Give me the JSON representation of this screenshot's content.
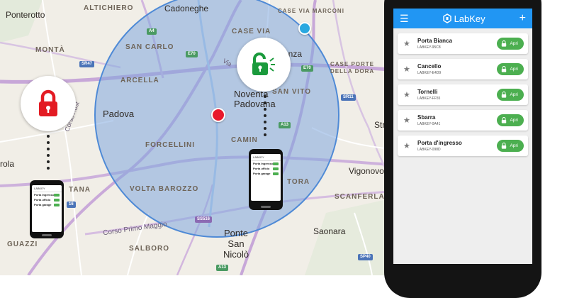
{
  "map": {
    "labels": {
      "ponterotto": "Ponterotto",
      "altichiero": "ALTICHIERO",
      "cadoneghe": "Cadoneghe",
      "case_via_marconi": "CASE VIA MARCONI",
      "case_via": "CASE VIA",
      "montà": "MONTÀ",
      "san_carlo": "SAN CARLO",
      "arcella": "ARCELLA",
      "case_porte": "CASE PORTE DELLA DORA",
      "noventa": "Noventa Padovana",
      "padova": "Padova",
      "san_vito": "SAN VITO",
      "forcellini": "FORCELLINI",
      "camin": "CAMIN",
      "vigonovo": "Vigonovo",
      "volta_barozzo": "VOLTA BAROZZO",
      "tora": "TORA",
      "scanferla": "SCANFERLA",
      "ponte_san_nicolo": "Ponte San Nicolò",
      "salboro": "SALBORO",
      "saonara": "Saonara",
      "guazzi": "GUAZZI",
      "tana": "TANA",
      "rola": "rola",
      "enza": "enza",
      "str": "Str",
      "corso_primo_maggio": "Corso Primo Maggio",
      "corso_aust": "Corso Aust",
      "via": "Via"
    },
    "shields": {
      "a4": "A4",
      "e70_a": "E70",
      "e70_b": "E70",
      "sr47": "SR47",
      "sr11": "SR11",
      "a13_a": "A13",
      "a13_b": "A13",
      "ss516": "SS516",
      "sp40": "SP40",
      "s16": "16"
    },
    "badges": {
      "locked_color": "#e31b23",
      "unlocked_color": "#1a9a3c"
    },
    "mini_phone": {
      "title": "LABKEY",
      "rows": [
        "Porta Ingresso",
        "Porta ufficio",
        "Porta garage"
      ]
    }
  },
  "app": {
    "title": "LabKey",
    "accent": "#2196f3",
    "button_color": "#4caf50",
    "icons": [
      "menu-icon",
      "labkey-logo-icon",
      "plus-icon",
      "star-icon",
      "padlock-icon"
    ],
    "doors": [
      {
        "name": "Porta Bianca",
        "code": "LABKEY-95C8",
        "action": "Apri"
      },
      {
        "name": "Cancello",
        "code": "LABKEY-E4D9",
        "action": "Apri"
      },
      {
        "name": "Tornelli",
        "code": "LABKEY-FF55",
        "action": "Apri"
      },
      {
        "name": "Sbarra",
        "code": "LABKEY-0A41",
        "action": "Apri"
      },
      {
        "name": "Porta d'ingresso",
        "code": "LABKEY-098D",
        "action": "Apri"
      }
    ]
  }
}
